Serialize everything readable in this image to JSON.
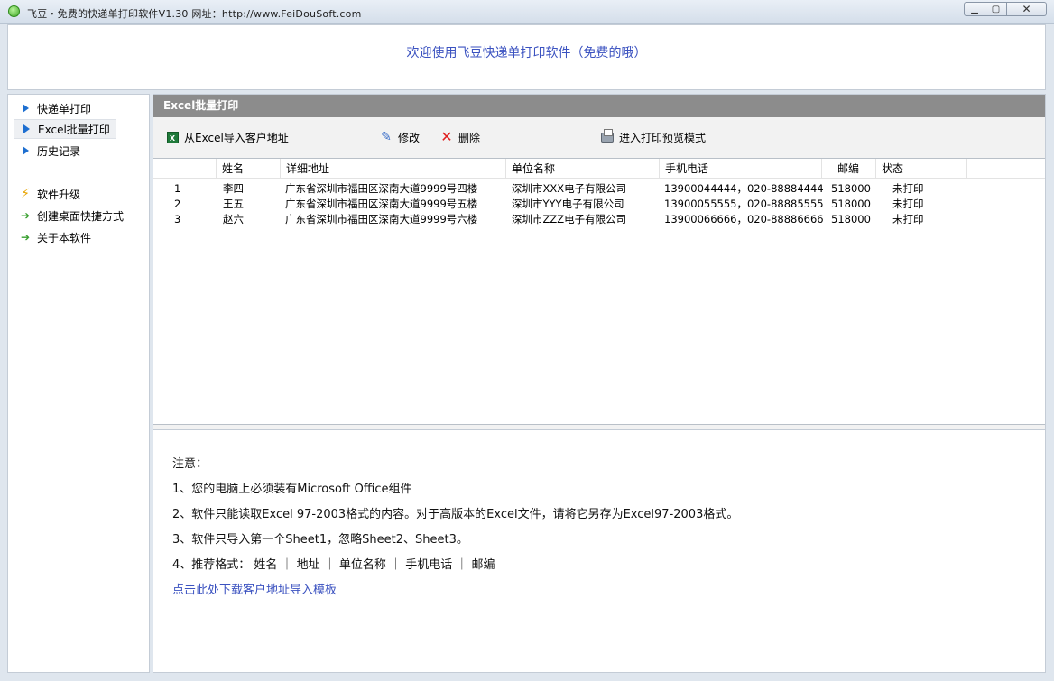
{
  "window": {
    "title": "飞豆・免费的快递单打印软件V1.30  网址：http://www.FeiDouSoft.com",
    "controls": {
      "minimize": "▁",
      "maximize": "▢",
      "close": "✕"
    }
  },
  "banner": {
    "text": "欢迎使用飞豆快递单打印软件（免费的哦）"
  },
  "sidebar": {
    "items": [
      {
        "label": "快递单打印",
        "icon": "play-triangle-icon"
      },
      {
        "label": "Excel批量打印",
        "icon": "play-triangle-icon",
        "selected": true
      },
      {
        "label": "历史记录",
        "icon": "play-triangle-icon"
      },
      {
        "label": "软件升级",
        "icon": "lightning-icon"
      },
      {
        "label": "创建桌面快捷方式",
        "icon": "green-arrow-icon"
      },
      {
        "label": "关于本软件",
        "icon": "green-arrow-icon"
      }
    ]
  },
  "panel": {
    "title": "Excel批量打印"
  },
  "toolbar": {
    "import_label": "从Excel导入客户地址",
    "edit_label": "修改",
    "delete_label": "删除",
    "preview_label": "进入打印预览模式"
  },
  "grid": {
    "columns": [
      "姓名",
      "详细地址",
      "单位名称",
      "手机电话",
      "邮编",
      "状态"
    ],
    "rows": [
      {
        "no": "1",
        "name": "李四",
        "address": "广东省深圳市福田区深南大道9999号四楼",
        "company": "深圳市XXX电子有限公司",
        "phone": "13900044444，020-88884444",
        "zip": "518000",
        "status": "未打印"
      },
      {
        "no": "2",
        "name": "王五",
        "address": "广东省深圳市福田区深南大道9999号五楼",
        "company": "深圳市YYY电子有限公司",
        "phone": "13900055555，020-88885555",
        "zip": "518000",
        "status": "未打印"
      },
      {
        "no": "3",
        "name": "赵六",
        "address": "广东省深圳市福田区深南大道9999号六楼",
        "company": "深圳市ZZZ电子有限公司",
        "phone": "13900066666，020-88886666",
        "zip": "518000",
        "status": "未打印"
      }
    ]
  },
  "notes": {
    "heading": "注意：",
    "lines": [
      "1、您的电脑上必须装有Microsoft Office组件",
      "2、软件只能读取Excel 97-2003格式的内容。对于高版本的Excel文件，请将它另存为Excel97-2003格式。",
      "3、软件只导入第一个Sheet1，忽略Sheet2、Sheet3。",
      "4、推荐格式：  姓名 ｜ 地址 ｜ 单位名称 ｜ 手机电话 ｜ 邮编"
    ],
    "link": "点击此处下载客户地址导入模板"
  }
}
